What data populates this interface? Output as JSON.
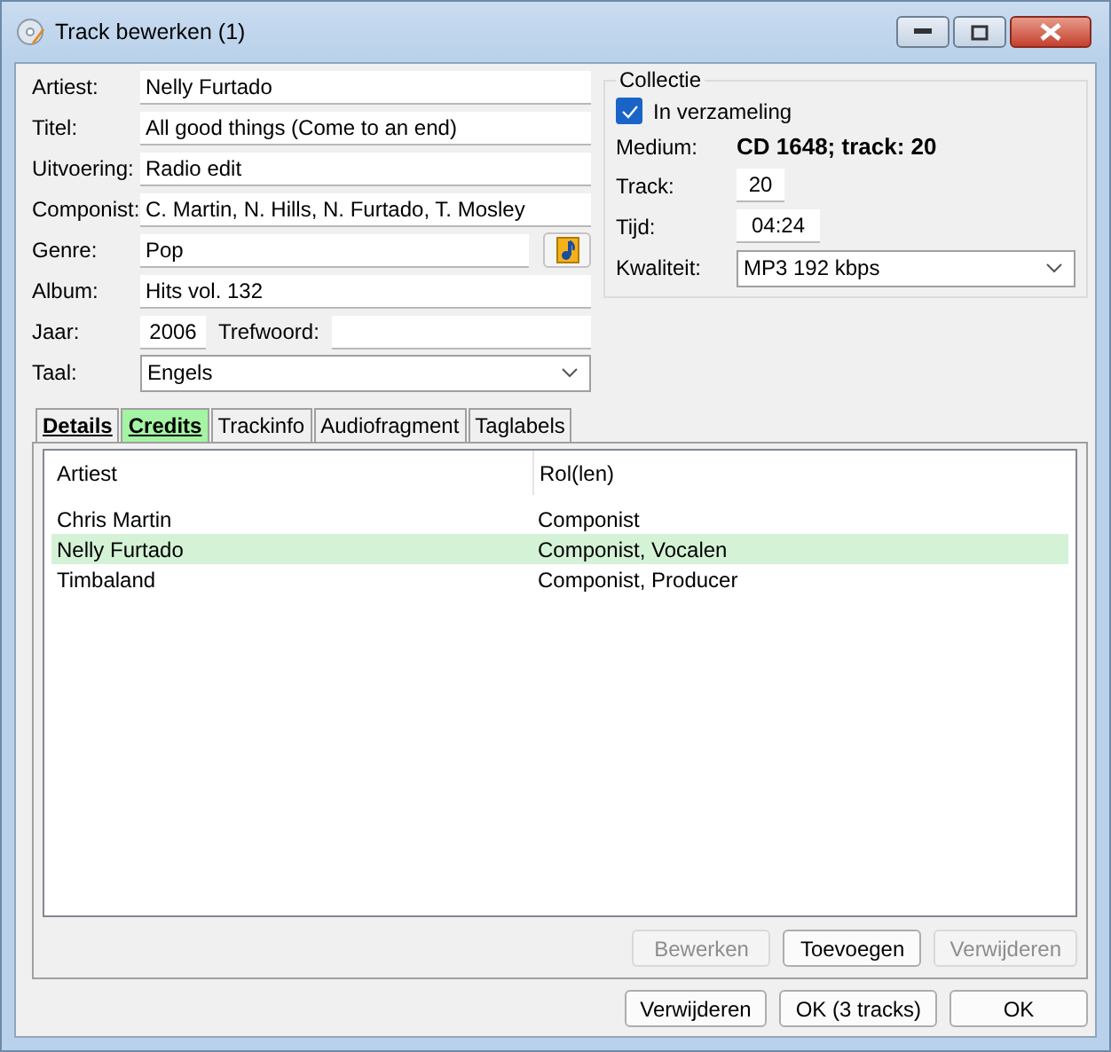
{
  "window": {
    "title": "Track bewerken (1)"
  },
  "form": [
    {
      "label": "Artiest:",
      "value": "Nelly Furtado",
      "kind": "text"
    },
    {
      "label": "Titel:",
      "value": "All good things (Come to an end)",
      "kind": "text"
    },
    {
      "label": "Uitvoering:",
      "value": "Radio edit",
      "kind": "text"
    },
    {
      "label": "Componist:",
      "value": "C. Martin, N. Hills, N. Furtado, T. Mosley",
      "kind": "text"
    },
    {
      "label": "Genre:",
      "value": "Pop",
      "kind": "with-button"
    },
    {
      "label": "Album:",
      "value": "Hits vol. 132",
      "kind": "text"
    },
    {
      "label": "Jaar:",
      "value": "2006",
      "kind": "year",
      "extra_label": "Trefwoord:"
    },
    {
      "label": "Taal:",
      "value": "Engels",
      "kind": "dropdown"
    }
  ],
  "collection": {
    "title": "Collectie",
    "checkbox": {
      "label": "In verzameling",
      "checked": true
    },
    "medium_label": "Medium:",
    "medium": "CD 1648; track: 20",
    "track_label": "Track:",
    "track": "20",
    "time_label": "Tijd:",
    "time": "04:24",
    "quality_label": "Kwaliteit:",
    "quality": "MP3 192 kbps"
  },
  "tabs": [
    {
      "label": "Details",
      "selected": false,
      "bold": true
    },
    {
      "label": "Credits",
      "selected": true,
      "bold": true
    },
    {
      "label": "Trackinfo",
      "selected": false,
      "bold": false
    },
    {
      "label": "Audiofragment",
      "selected": false,
      "bold": false
    },
    {
      "label": "Taglabels",
      "selected": false,
      "bold": false
    }
  ],
  "table": {
    "columns": [
      "Artiest",
      "Rol(len)"
    ],
    "rows": [
      {
        "cells": [
          "Chris Martin",
          "Componist"
        ],
        "selected": false
      },
      {
        "cells": [
          "Nelly Furtado",
          "Componist, Vocalen"
        ],
        "selected": true
      },
      {
        "cells": [
          "Timbaland",
          "Componist, Producer"
        ],
        "selected": false
      }
    ]
  },
  "list_buttons": [
    {
      "label": "Bewerken",
      "disabled": true
    },
    {
      "label": "Toevoegen",
      "disabled": false
    },
    {
      "label": "Verwijderen",
      "disabled": true
    }
  ],
  "footer_buttons": [
    {
      "label": "Verwijderen"
    },
    {
      "label": "OK (3 tracks)"
    },
    {
      "label": "OK"
    }
  ]
}
